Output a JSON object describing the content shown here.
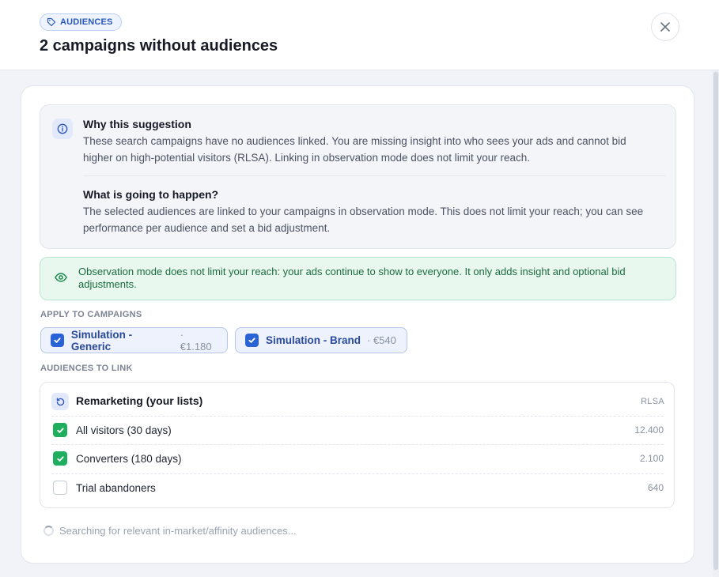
{
  "header": {
    "tag_label": "AUDIENCES",
    "title": "2 campaigns without audiences"
  },
  "info": {
    "why_title": "Why this suggestion",
    "why_text": "These search campaigns have no audiences linked. You are missing insight into who sees your ads and cannot bid higher on high-potential visitors (RLSA). Linking in observation mode does not limit your reach.",
    "what_title": "What is going to happen?",
    "what_text": "The selected audiences are linked to your campaigns in observation mode. This does not limit your reach; you can see performance per audience and set a bid adjustment."
  },
  "notice": {
    "text": "Observation mode does not limit your reach: your ads continue to show to everyone. It only adds insight and optional bid adjustments."
  },
  "campaigns": {
    "label": "APPLY TO CAMPAIGNS",
    "items": [
      {
        "name": "Simulation - Generic",
        "amount": "· €1.180",
        "checked": true
      },
      {
        "name": "Simulation - Brand",
        "amount": "· €540",
        "checked": true
      }
    ]
  },
  "audiences": {
    "label": "AUDIENCES TO LINK",
    "group_title": "Remarketing (your lists)",
    "group_tag": "RLSA",
    "items": [
      {
        "label": "All visitors (30 days)",
        "size": "12.400",
        "checked": true
      },
      {
        "label": "Converters (180 days)",
        "size": "2.100",
        "checked": true
      },
      {
        "label": "Trial abandoners",
        "size": "640",
        "checked": false
      }
    ]
  },
  "loading_text": "Searching for relevant in-market/affinity audiences...",
  "colors": {
    "accent_blue": "#2a63d6",
    "check_green": "#1fae5e",
    "notice_green": "#1b6b3f"
  }
}
